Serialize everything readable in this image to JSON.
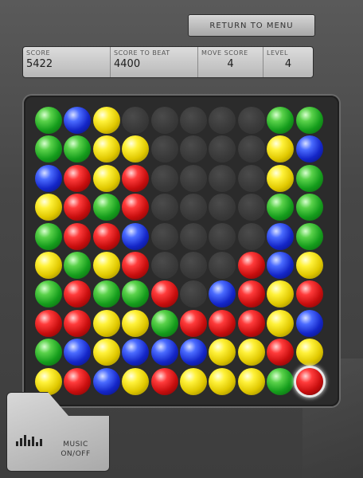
{
  "header": {
    "return_label": "RETURN TO MENU"
  },
  "stats": [
    {
      "label": "SCORE",
      "value": "5422"
    },
    {
      "label": "SCORE TO BEAT",
      "value": "4400"
    },
    {
      "label": "MOVE SCORE",
      "value": "4"
    },
    {
      "label": "LEVEL",
      "value": "4"
    }
  ],
  "music": {
    "line1": "MUSIC",
    "line2": "ON/OFF",
    "icon": "equalizer-icon"
  },
  "colors": {
    "green": "#159d1c",
    "blue": "#1426c8",
    "yellow": "#e0c800",
    "red": "#c80e0e",
    "empty": "#383838"
  },
  "board": {
    "rows": [
      [
        "green",
        "blue",
        "yellow",
        "empty",
        "empty",
        "empty",
        "empty",
        "empty",
        "green",
        "green"
      ],
      [
        "green",
        "green",
        "yellow",
        "yellow",
        "empty",
        "empty",
        "empty",
        "empty",
        "yellow",
        "blue"
      ],
      [
        "blue",
        "red",
        "yellow",
        "red",
        "empty",
        "empty",
        "empty",
        "empty",
        "yellow",
        "green"
      ],
      [
        "yellow",
        "red",
        "green",
        "red",
        "empty",
        "empty",
        "empty",
        "empty",
        "green",
        "green"
      ],
      [
        "green",
        "red",
        "red",
        "blue",
        "empty",
        "empty",
        "empty",
        "empty",
        "blue",
        "green"
      ],
      [
        "yellow",
        "green",
        "yellow",
        "red",
        "empty",
        "empty",
        "empty",
        "red",
        "blue",
        "yellow"
      ],
      [
        "green",
        "red",
        "green",
        "green",
        "red",
        "empty",
        "blue",
        "red",
        "yellow",
        "red"
      ],
      [
        "red",
        "red",
        "yellow",
        "yellow",
        "green",
        "red",
        "red",
        "red",
        "yellow",
        "blue"
      ],
      [
        "green",
        "blue",
        "yellow",
        "blue",
        "blue",
        "blue",
        "yellow",
        "yellow",
        "red",
        "yellow"
      ],
      [
        "yellow",
        "red",
        "blue",
        "yellow",
        "red",
        "yellow",
        "yellow",
        "yellow",
        "green",
        "red"
      ]
    ],
    "selected": {
      "row": 9,
      "col": 9
    }
  }
}
